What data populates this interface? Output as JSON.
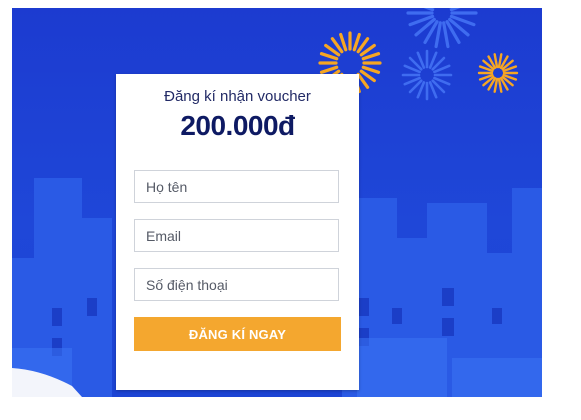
{
  "form": {
    "title": "Đăng kí nhận voucher",
    "amount": "200.000đ",
    "name_placeholder": "Họ tên",
    "email_placeholder": "Email",
    "phone_placeholder": "Số điện thoại",
    "submit_label": "ĐĂNG KÍ NGAY"
  },
  "colors": {
    "background": "#1f47d8",
    "buildings": "#2a5ae6",
    "firework_orange": "#f6a623",
    "firework_blue": "#3f6cf0",
    "button": "#f4a72f",
    "amount_text": "#0e1a63"
  }
}
